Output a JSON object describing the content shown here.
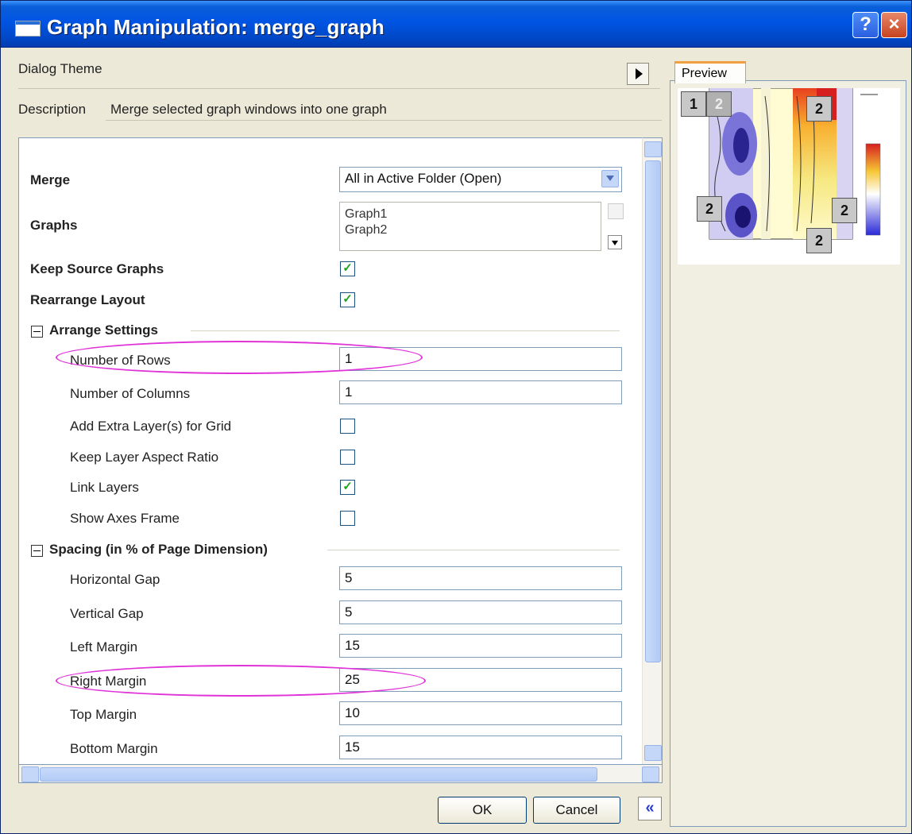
{
  "window": {
    "title": "Graph Manipulation: merge_graph",
    "help_label": "?",
    "close_label": "×"
  },
  "header": {
    "dialog_theme_label": "Dialog Theme",
    "description_label": "Description",
    "description_text": "Merge selected graph windows into one graph"
  },
  "settings": {
    "merge": {
      "label": "Merge",
      "value": "All in Active Folder (Open)"
    },
    "graphs": {
      "label": "Graphs",
      "items": [
        "Graph1",
        "Graph2"
      ]
    },
    "keep_source": {
      "label": "Keep Source Graphs",
      "checked": true
    },
    "rearrange": {
      "label": "Rearrange Layout",
      "checked": true
    },
    "arrange": {
      "title": "Arrange Settings",
      "rows": {
        "label": "Number of Rows",
        "value": "1"
      },
      "columns": {
        "label": "Number of Columns",
        "value": "1"
      },
      "extra_layers": {
        "label": "Add Extra Layer(s) for Grid",
        "checked": false
      },
      "aspect_ratio": {
        "label": "Keep Layer Aspect Ratio",
        "checked": false
      },
      "link_layers": {
        "label": "Link Layers",
        "checked": true
      },
      "axes_frame": {
        "label": "Show Axes Frame",
        "checked": false
      }
    },
    "spacing": {
      "title": "Spacing (in % of Page Dimension)",
      "horizontal_gap": {
        "label": "Horizontal Gap",
        "value": "5"
      },
      "vertical_gap": {
        "label": "Vertical Gap",
        "value": "5"
      },
      "left_margin": {
        "label": "Left Margin",
        "value": "15"
      },
      "right_margin": {
        "label": "Right Margin",
        "value": "25"
      },
      "top_margin": {
        "label": "Top Margin",
        "value": "10"
      },
      "bottom_margin": {
        "label": "Bottom Margin",
        "value": "15"
      }
    }
  },
  "footer": {
    "ok_label": "OK",
    "cancel_label": "Cancel",
    "collapse_label": "«"
  },
  "preview": {
    "tab_label": "Preview",
    "badges": [
      "1",
      "2",
      "2",
      "2",
      "2",
      "2"
    ]
  },
  "check_mark": "✓",
  "colors": {
    "highlight": "#e033d8",
    "title_bar": "#0054e3"
  }
}
